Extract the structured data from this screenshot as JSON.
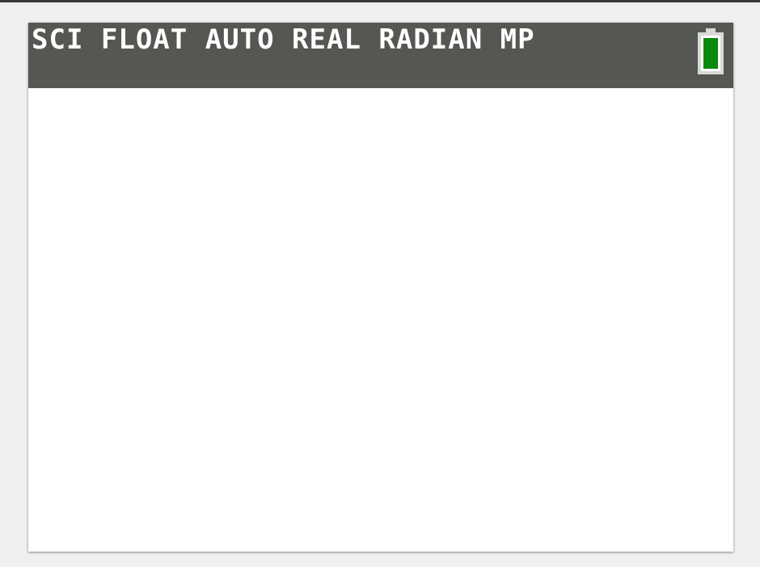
{
  "status_bar": {
    "mode_text": "SCI FLOAT AUTO REAL RADIAN MP",
    "battery_icon": "battery-icon",
    "battery_color": "#0a8a0a",
    "colors": {
      "bar": "#555753",
      "text": "#ffffff"
    }
  },
  "screen": {
    "background": "#ffffff"
  }
}
